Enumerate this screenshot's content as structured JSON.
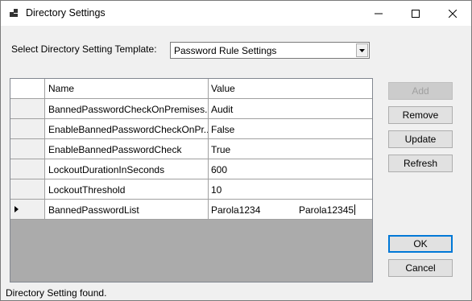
{
  "window": {
    "title": "Directory Settings"
  },
  "template": {
    "label": "Select Directory Setting Template:",
    "selected": "Password Rule Settings"
  },
  "grid": {
    "columns": [
      "Name",
      "Value"
    ],
    "rows": [
      {
        "name": "BannedPasswordCheckOnPremises...",
        "value": "Audit"
      },
      {
        "name": "EnableBannedPasswordCheckOnPr...",
        "value": "False"
      },
      {
        "name": "EnableBannedPasswordCheck",
        "value": "True"
      },
      {
        "name": "LockoutDurationInSeconds",
        "value": "600"
      },
      {
        "name": "LockoutThreshold",
        "value": "10"
      },
      {
        "name": "BannedPasswordList",
        "value": "Parola1234",
        "value2": "Parola12345"
      }
    ]
  },
  "buttons": {
    "add": "Add",
    "remove": "Remove",
    "update": "Update",
    "refresh": "Refresh",
    "ok": "OK",
    "cancel": "Cancel"
  },
  "status": "Directory Setting found."
}
